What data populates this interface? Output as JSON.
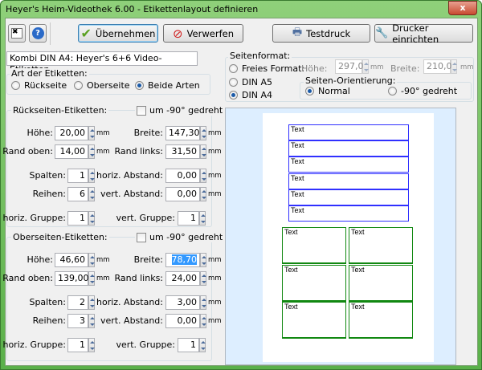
{
  "window": {
    "title": "Heyer's Heim-Videothek 6.00 - Etikettenlayout definieren",
    "close": "x"
  },
  "toolbar": {
    "apply": "Übernehmen",
    "discard": "Verwerfen",
    "testprint": "Testdruck",
    "printer_setup": "Drucker einrichten"
  },
  "layout_name": "Kombi DIN A4: Heyer's 6+6 Video-Etiketten",
  "label_type": {
    "legend": "Art der Etiketten:",
    "options": [
      "Rückseite",
      "Oberseite",
      "Beide Arten"
    ],
    "selected": "Beide Arten"
  },
  "groups": [
    {
      "legend": "Rückseiten-Etiketten:",
      "rotate_label": "um -90° gedreht",
      "rotate": false,
      "fields": {
        "hoehe": "20,00",
        "breite": "147,30",
        "rand_oben": "14,00",
        "rand_links": "31,50",
        "spalten": "1",
        "horiz_abstand": "0,00",
        "reihen": "6",
        "vert_abstand": "0,00",
        "horiz_gruppe": "1",
        "vert_gruppe": "1"
      }
    },
    {
      "legend": "Oberseiten-Etiketten:",
      "rotate_label": "um -90° gedreht",
      "rotate": false,
      "fields": {
        "hoehe": "46,60",
        "breite": "78,70",
        "rand_oben": "139,00",
        "rand_links": "24,00",
        "spalten": "2",
        "horiz_abstand": "3,00",
        "reihen": "3",
        "vert_abstand": "0,00",
        "horiz_gruppe": "1",
        "vert_gruppe": "1"
      }
    }
  ],
  "field_labels": {
    "hoehe": "Höhe:",
    "breite": "Breite:",
    "rand_oben": "Rand oben:",
    "rand_links": "Rand links:",
    "spalten": "Spalten:",
    "horiz_abstand": "horiz. Abstand:",
    "reihen": "Reihen:",
    "vert_abstand": "vert. Abstand:",
    "horiz_gruppe": "horiz. Gruppe:",
    "vert_gruppe": "vert. Gruppe:",
    "unit": "mm"
  },
  "page_format": {
    "legend": "Seitenformat:",
    "free": "Freies Format:",
    "a5": "DIN A5",
    "a4": "DIN A4",
    "selected": "DIN A4",
    "hoehe_label": "Höhe:",
    "hoehe": "297,0",
    "breite_label": "Breite:",
    "breite": "210,0",
    "unit": "mm"
  },
  "orientation": {
    "legend": "Seiten-Orientierung:",
    "normal": "Normal",
    "rotated": "-90° gedreht",
    "selected": "Normal"
  },
  "preview": {
    "label_text": "Text",
    "back_color": "#3030ff",
    "front_color": "#118811"
  }
}
